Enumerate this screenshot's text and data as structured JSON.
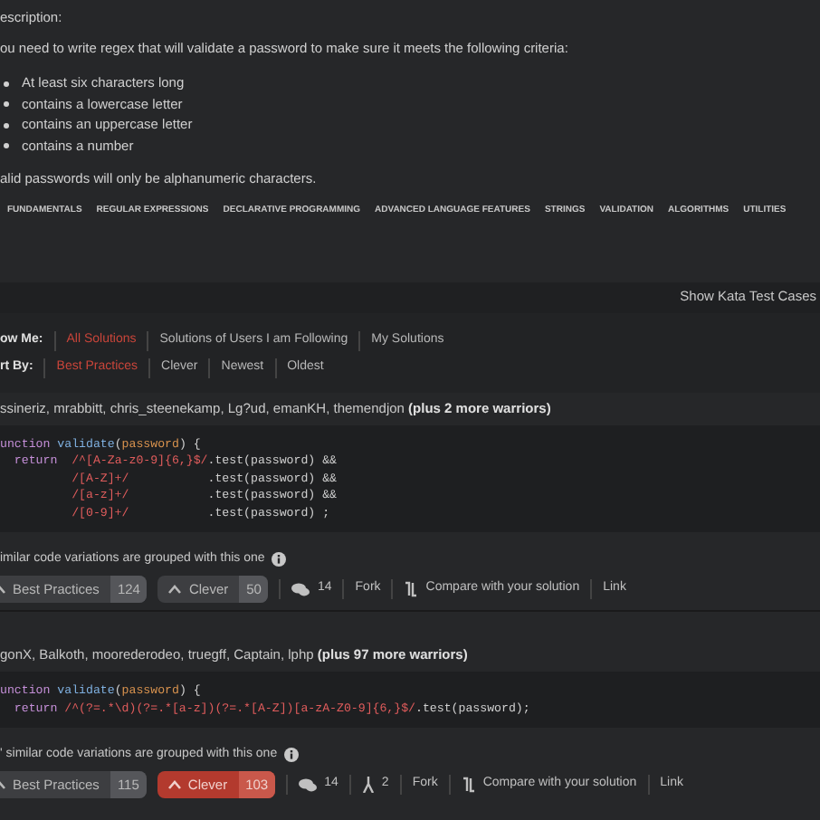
{
  "description": {
    "heading": "escription:",
    "intro": "ou need to write regex that will validate a password to make sure it meets the following criteria:",
    "criteria": [
      "At least six characters long",
      "contains a lowercase letter",
      "contains an uppercase letter",
      "contains a number"
    ],
    "note": "alid passwords will only be alphanumeric characters."
  },
  "tags": [
    "FUNDAMENTALS",
    "REGULAR EXPRESSIONS",
    "DECLARATIVE PROGRAMMING",
    "ADVANCED LANGUAGE FEATURES",
    "STRINGS",
    "VALIDATION",
    "ALGORITHMS",
    "UTILITIES"
  ],
  "test_cases_button": "Show Kata Test Cases",
  "filters": [
    {
      "label": "ow Me:",
      "options": [
        {
          "label": "All Solutions",
          "selected": true
        },
        {
          "label": "Solutions of Users I am Following",
          "selected": false
        },
        {
          "label": "My Solutions",
          "selected": false
        }
      ]
    },
    {
      "label": "rt By:",
      "options": [
        {
          "label": "Best Practices",
          "selected": true
        },
        {
          "label": "Clever",
          "selected": false
        },
        {
          "label": "Newest",
          "selected": false
        },
        {
          "label": "Oldest",
          "selected": false
        }
      ]
    }
  ],
  "solutions": [
    {
      "authors": "ssineriz, mrabbitt, chris_steenekamp, Lg?ud, emanKH, themendjon",
      "more": "(plus 2 more warriors)",
      "code": [
        [
          {
            "kind": "keyword",
            "text": "unction "
          },
          {
            "kind": "func",
            "text": "validate"
          },
          {
            "kind": "plain",
            "text": "("
          },
          {
            "kind": "param",
            "text": "password"
          },
          {
            "kind": "plain",
            "text": ") {"
          }
        ],
        [
          {
            "kind": "keyword",
            "text": "  return  "
          },
          {
            "kind": "regex",
            "text": "/^[A-Za-z0-9]{6,}$/"
          },
          {
            "kind": "plain",
            "text": ".test(password) &&"
          }
        ],
        [
          {
            "kind": "regex",
            "text": "          /[A-Z]+/"
          },
          {
            "kind": "plain",
            "text": "           .test(password) &&"
          }
        ],
        [
          {
            "kind": "regex",
            "text": "          /[a-z]+/"
          },
          {
            "kind": "plain",
            "text": "           .test(password) &&"
          }
        ],
        [
          {
            "kind": "regex",
            "text": "          /[0-9]+/"
          },
          {
            "kind": "plain",
            "text": "           .test(password) ;"
          }
        ]
      ],
      "similar": "imilar code variations are grouped with this one",
      "best_practices": {
        "label": "Best Practices",
        "count": "124",
        "selected": false
      },
      "clever": {
        "label": "Clever",
        "count": "50",
        "selected": false
      },
      "comments": "14",
      "actions": [
        "Fork",
        "Compare with your solution",
        "Link"
      ]
    },
    {
      "authors": "gonX, Balkoth, moorederodeo, truegff, Captain, lphp",
      "more": "(plus 97 more warriors)",
      "code": [
        [
          {
            "kind": "keyword",
            "text": "unction "
          },
          {
            "kind": "func",
            "text": "validate"
          },
          {
            "kind": "plain",
            "text": "("
          },
          {
            "kind": "param",
            "text": "password"
          },
          {
            "kind": "plain",
            "text": ") {"
          }
        ],
        [
          {
            "kind": "keyword",
            "text": "  return "
          },
          {
            "kind": "regex",
            "text": "/^(?=.*\\d)(?=.*[a-z])(?=.*[A-Z])[a-zA-Z0-9]{6,}$/"
          },
          {
            "kind": "plain",
            "text": ".test(password);"
          }
        ]
      ],
      "similar": "' similar code variations are grouped with this one",
      "best_practices": {
        "label": "Best Practices",
        "count": "115",
        "selected": false
      },
      "clever": {
        "label": "Clever",
        "count": "103",
        "selected": true
      },
      "comments": "14",
      "forks": "2",
      "actions": [
        "Fork",
        "Compare with your solution",
        "Link"
      ]
    }
  ]
}
